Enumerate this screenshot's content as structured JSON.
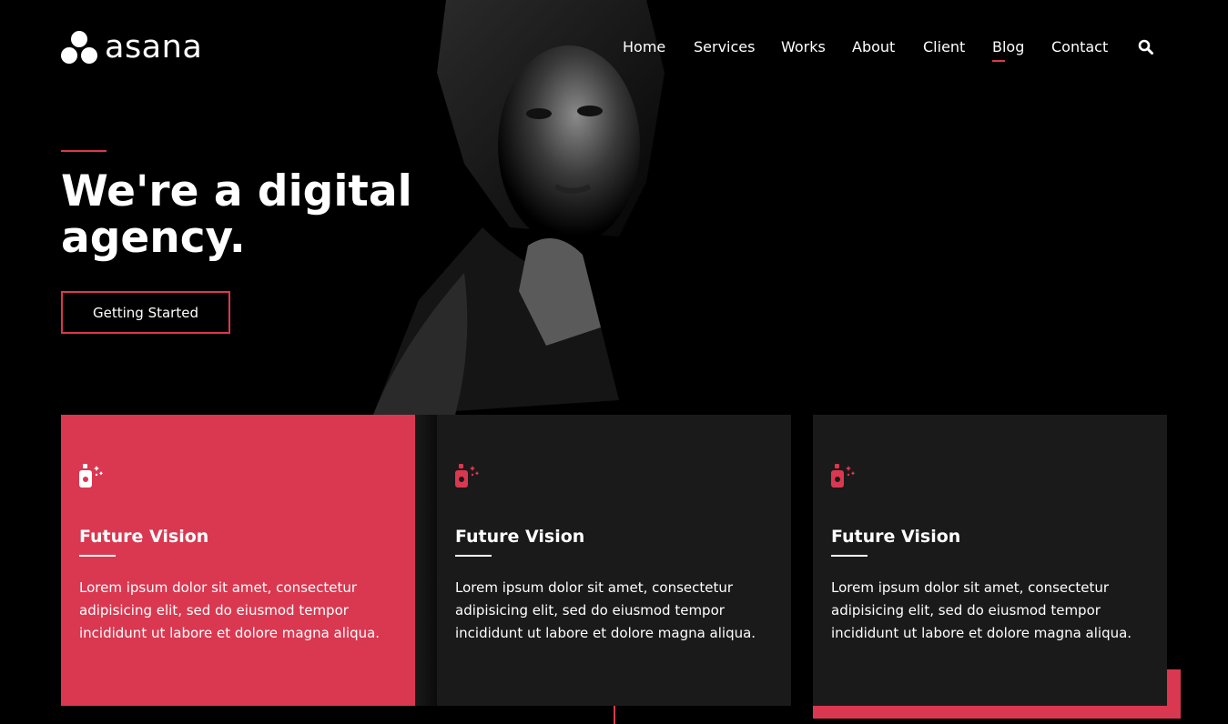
{
  "brand": {
    "name": "asana",
    "logo_icon": "three-dots-logo-icon"
  },
  "nav": {
    "items": [
      {
        "label": "Home",
        "active": false
      },
      {
        "label": "Services",
        "active": false
      },
      {
        "label": "Works",
        "active": false
      },
      {
        "label": "About",
        "active": false
      },
      {
        "label": "Client",
        "active": false
      },
      {
        "label": "Blog",
        "active": true
      },
      {
        "label": "Contact",
        "active": false
      }
    ],
    "search_icon": "search-icon"
  },
  "hero": {
    "title_line1": "We're a digital",
    "title_line2": "agency.",
    "cta_label": "Getting Started"
  },
  "cards": [
    {
      "icon": "spray-bottle-icon",
      "title": "Future Vision",
      "text": "Lorem ipsum dolor sit amet, consectetur adipisicing elit, sed do eiusmod tempor incididunt ut labore et dolore magna aliqua."
    },
    {
      "icon": "spray-bottle-icon",
      "title": "Future Vision",
      "text": "Lorem ipsum dolor sit amet, consectetur adipisicing elit, sed do eiusmod tempor incididunt ut labore et dolore magna aliqua."
    },
    {
      "icon": "spray-bottle-icon",
      "title": "Future Vision",
      "text": "Lorem ipsum dolor sit amet, consectetur adipisicing elit, sed do eiusmod tempor incididunt ut labore et dolore magna aliqua."
    }
  ],
  "colors": {
    "accent": "#d93850",
    "background": "#000000",
    "card_dark": "#1a1a1a",
    "text": "#ffffff"
  }
}
